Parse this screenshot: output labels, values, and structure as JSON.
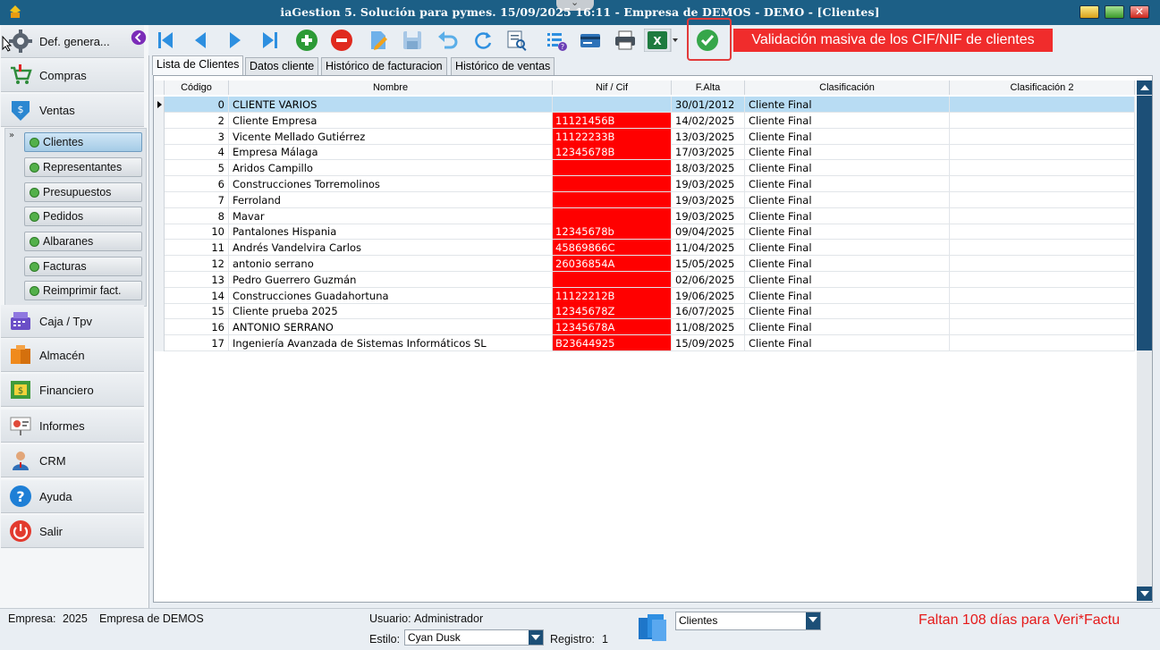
{
  "window": {
    "title": "iaGestion 5. Solución para pymes.   15/09/2025 16:11  -  Empresa de DEMOS - DEMO - [Clientes]"
  },
  "sidebar": {
    "items": [
      {
        "label": "Def. genera...",
        "icon": "gear-icon"
      },
      {
        "label": "Compras",
        "icon": "shopping-cart-icon"
      },
      {
        "label": "Ventas",
        "icon": "ventas-icon"
      },
      {
        "label": "Caja / Tpv",
        "icon": "cash-register-icon"
      },
      {
        "label": "Almacén",
        "icon": "warehouse-icon"
      },
      {
        "label": "Financiero",
        "icon": "money-icon"
      },
      {
        "label": "Informes",
        "icon": "report-icon"
      },
      {
        "label": "CRM",
        "icon": "person-icon"
      },
      {
        "label": "Ayuda",
        "icon": "help-icon"
      },
      {
        "label": "Salir",
        "icon": "power-icon"
      }
    ],
    "ventas_sub": [
      "Clientes",
      "Representantes",
      "Presupuestos",
      "Pedidos",
      "Albaranes",
      "Facturas",
      "Reimprimir fact."
    ]
  },
  "toolbar": {
    "tooltip": "Validación masiva de los CIF/NIF de clientes"
  },
  "tabs": [
    "Lista de Clientes",
    "Datos cliente",
    "Histórico de facturacion",
    "Histórico de ventas"
  ],
  "grid": {
    "columns": [
      "Código",
      "Nombre",
      "Nif / Cif",
      "F.Alta",
      "Clasificación",
      "Clasificación 2"
    ],
    "rows": [
      {
        "codigo": "0",
        "nombre": "CLIENTE VARIOS",
        "nif": "",
        "nif_invalid": false,
        "alta": "30/01/2012",
        "clasif": "Cliente Final",
        "clasif2": ""
      },
      {
        "codigo": "2",
        "nombre": "Cliente Empresa",
        "nif": "11121456B",
        "nif_invalid": true,
        "alta": "14/02/2025",
        "clasif": "Cliente Final",
        "clasif2": ""
      },
      {
        "codigo": "3",
        "nombre": "Vicente Mellado Gutiérrez",
        "nif": "11122233B",
        "nif_invalid": true,
        "alta": "13/03/2025",
        "clasif": "Cliente Final",
        "clasif2": ""
      },
      {
        "codigo": "4",
        "nombre": "Empresa Málaga",
        "nif": "12345678B",
        "nif_invalid": true,
        "alta": "17/03/2025",
        "clasif": "Cliente Final",
        "clasif2": ""
      },
      {
        "codigo": "5",
        "nombre": "Aridos Campillo",
        "nif": "",
        "nif_invalid": true,
        "alta": "18/03/2025",
        "clasif": "Cliente Final",
        "clasif2": ""
      },
      {
        "codigo": "6",
        "nombre": "Construcciones Torremolinos",
        "nif": "",
        "nif_invalid": true,
        "alta": "19/03/2025",
        "clasif": "Cliente Final",
        "clasif2": ""
      },
      {
        "codigo": "7",
        "nombre": "Ferroland",
        "nif": "",
        "nif_invalid": true,
        "alta": "19/03/2025",
        "clasif": "Cliente Final",
        "clasif2": ""
      },
      {
        "codigo": "8",
        "nombre": "Mavar",
        "nif": "",
        "nif_invalid": true,
        "alta": "19/03/2025",
        "clasif": "Cliente Final",
        "clasif2": ""
      },
      {
        "codigo": "10",
        "nombre": "Pantalones Hispania",
        "nif": "12345678b",
        "nif_invalid": true,
        "alta": "09/04/2025",
        "clasif": "Cliente Final",
        "clasif2": ""
      },
      {
        "codigo": "11",
        "nombre": "Andrés Vandelvira Carlos",
        "nif": "45869866C",
        "nif_invalid": true,
        "alta": "11/04/2025",
        "clasif": "Cliente Final",
        "clasif2": ""
      },
      {
        "codigo": "12",
        "nombre": "antonio serrano",
        "nif": "26036854A",
        "nif_invalid": true,
        "alta": "15/05/2025",
        "clasif": "Cliente Final",
        "clasif2": ""
      },
      {
        "codigo": "13",
        "nombre": "Pedro Guerrero Guzmán",
        "nif": "",
        "nif_invalid": true,
        "alta": "02/06/2025",
        "clasif": "Cliente Final",
        "clasif2": ""
      },
      {
        "codigo": "14",
        "nombre": "Construcciones Guadahortuna",
        "nif": "11122212B",
        "nif_invalid": true,
        "alta": "19/06/2025",
        "clasif": "Cliente Final",
        "clasif2": ""
      },
      {
        "codigo": "15",
        "nombre": "Cliente prueba 2025",
        "nif": "12345678Z",
        "nif_invalid": true,
        "alta": "16/07/2025",
        "clasif": "Cliente Final",
        "clasif2": ""
      },
      {
        "codigo": "16",
        "nombre": "ANTONIO SERRANO",
        "nif": "12345678A",
        "nif_invalid": true,
        "alta": "11/08/2025",
        "clasif": "Cliente Final",
        "clasif2": ""
      },
      {
        "codigo": "17",
        "nombre": "Ingeniería Avanzada de Sistemas Informáticos SL",
        "nif": "B23644925",
        "nif_invalid": true,
        "alta": "15/09/2025",
        "clasif": "Cliente Final",
        "clasif2": ""
      }
    ]
  },
  "status": {
    "empresa_label": "Empresa:",
    "empresa_year": "2025",
    "empresa_name": "Empresa de DEMOS",
    "usuario_label": "Usuario:",
    "usuario": "Administrador",
    "estilo_label": "Estilo:",
    "estilo": "Cyan Dusk",
    "registro_label": "Registro:",
    "registro": "1",
    "vista": "Clientes",
    "warning": "Faltan 108 días para Veri*Factu"
  },
  "colors": {
    "titlebar": "#1c5f86",
    "invalid_nif": "#ff0000",
    "selected_row": "#b8dcf3",
    "tooltip": "#f02c2c"
  }
}
